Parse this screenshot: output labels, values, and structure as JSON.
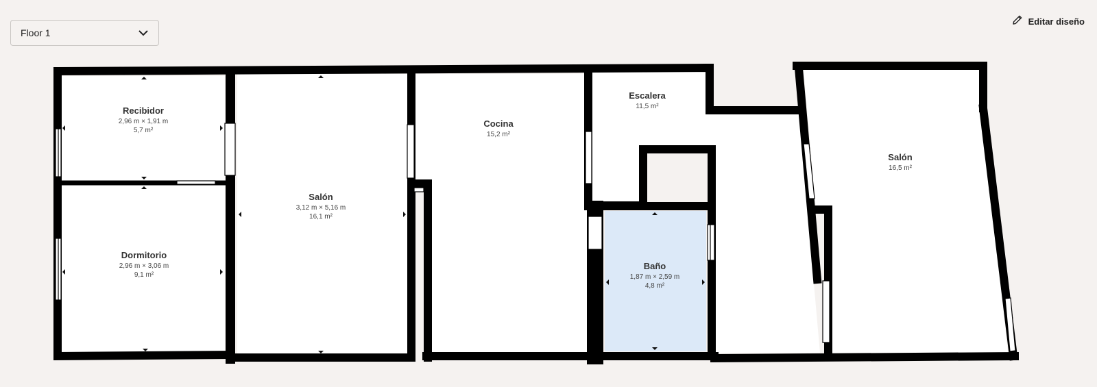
{
  "floor_select": {
    "value": "Floor 1",
    "icon": "chevron-down-icon"
  },
  "edit_button": {
    "label": "Editar diseño",
    "icon": "pencil-icon"
  },
  "rooms": [
    {
      "name": "Recibidor",
      "dimensions": "2,96 m × 1,91 m",
      "area": "5,7 m²"
    },
    {
      "name": "Dormitorio",
      "dimensions": "2,96 m × 3,06 m",
      "area": "9,1 m²"
    },
    {
      "name": "Salón",
      "dimensions": "3,12 m × 5,16 m",
      "area": "16,1 m²"
    },
    {
      "name": "Cocina",
      "dimensions": "",
      "area": "15,2 m²"
    },
    {
      "name": "Escalera",
      "dimensions": "",
      "area": "11,5 m²"
    },
    {
      "name": "Baño",
      "dimensions": "1,87 m × 2,59 m",
      "area": "4,8 m²",
      "highlighted": true
    },
    {
      "name": "Salón",
      "dimensions": "",
      "area": "16,5 m²"
    }
  ],
  "colors": {
    "wall": "#000000",
    "background": "#f5f2f0",
    "highlight": "#dce9f8",
    "floor": "#ffffff"
  }
}
